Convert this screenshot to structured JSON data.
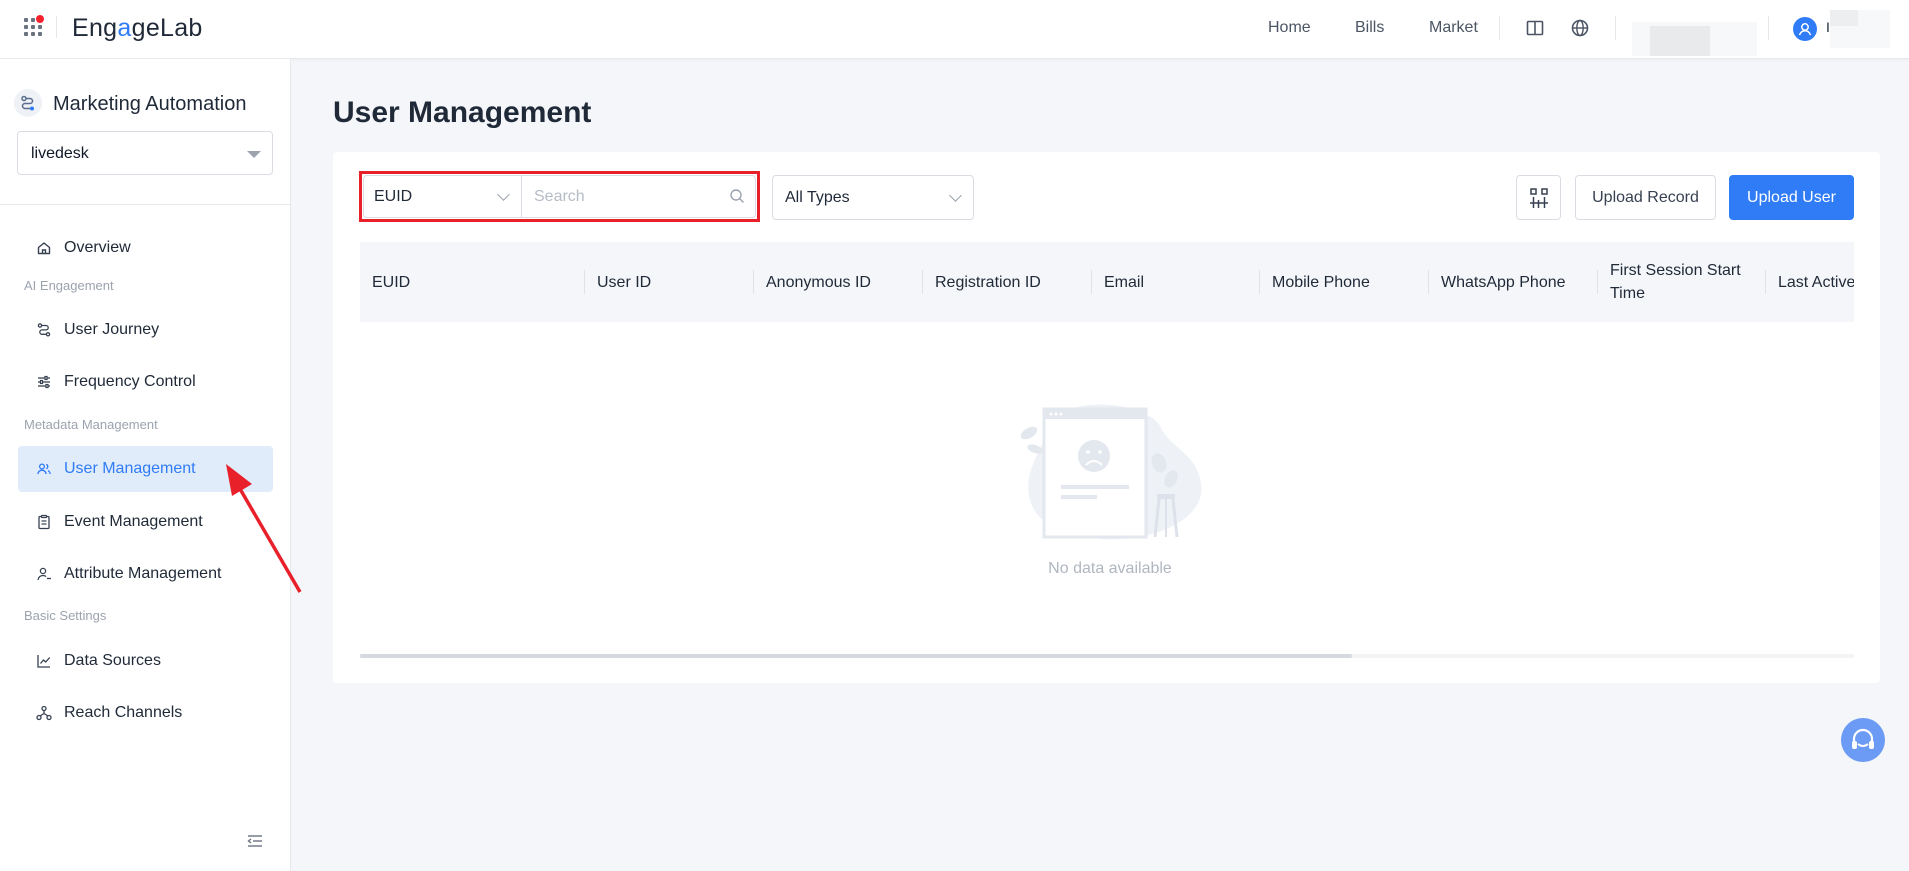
{
  "header": {
    "logo_prefix": "Eng",
    "logo_accent": "a",
    "logo_suffix": "geLab",
    "nav": [
      {
        "label": "Home"
      },
      {
        "label": "Bills"
      },
      {
        "label": "Market"
      }
    ],
    "user_initial": "I"
  },
  "sidebar": {
    "app_title": "Marketing Automation",
    "project": "livedesk",
    "groups": {
      "ai_engagement": "AI Engagement",
      "metadata": "Metadata Management",
      "basic": "Basic Settings"
    },
    "items": [
      {
        "label": "Overview",
        "icon": "home-icon"
      },
      {
        "label": "User Journey",
        "icon": "journey-icon"
      },
      {
        "label": "Frequency Control",
        "icon": "sliders-icon"
      },
      {
        "label": "User Management",
        "icon": "users-icon",
        "active": true
      },
      {
        "label": "Event Management",
        "icon": "clipboard-icon"
      },
      {
        "label": "Attribute Management",
        "icon": "user-attribute-icon"
      },
      {
        "label": "Data Sources",
        "icon": "line-chart-icon"
      },
      {
        "label": "Reach Channels",
        "icon": "network-icon"
      }
    ]
  },
  "main": {
    "title": "User Management",
    "filter": {
      "field": "EUID",
      "search_placeholder": "Search",
      "type": "All Types"
    },
    "actions": {
      "upload_record": "Upload Record",
      "upload_user": "Upload User"
    },
    "table": {
      "columns": [
        "EUID",
        "User ID",
        "Anonymous ID",
        "Registration ID",
        "Email",
        "Mobile Phone",
        "WhatsApp Phone",
        "First Session Start Time",
        "Last Active"
      ],
      "rows": [],
      "empty_text": "No data available"
    }
  },
  "colors": {
    "primary": "#2f7cf6",
    "highlight": "#e8202a",
    "active_bg": "#e1ecfb"
  }
}
